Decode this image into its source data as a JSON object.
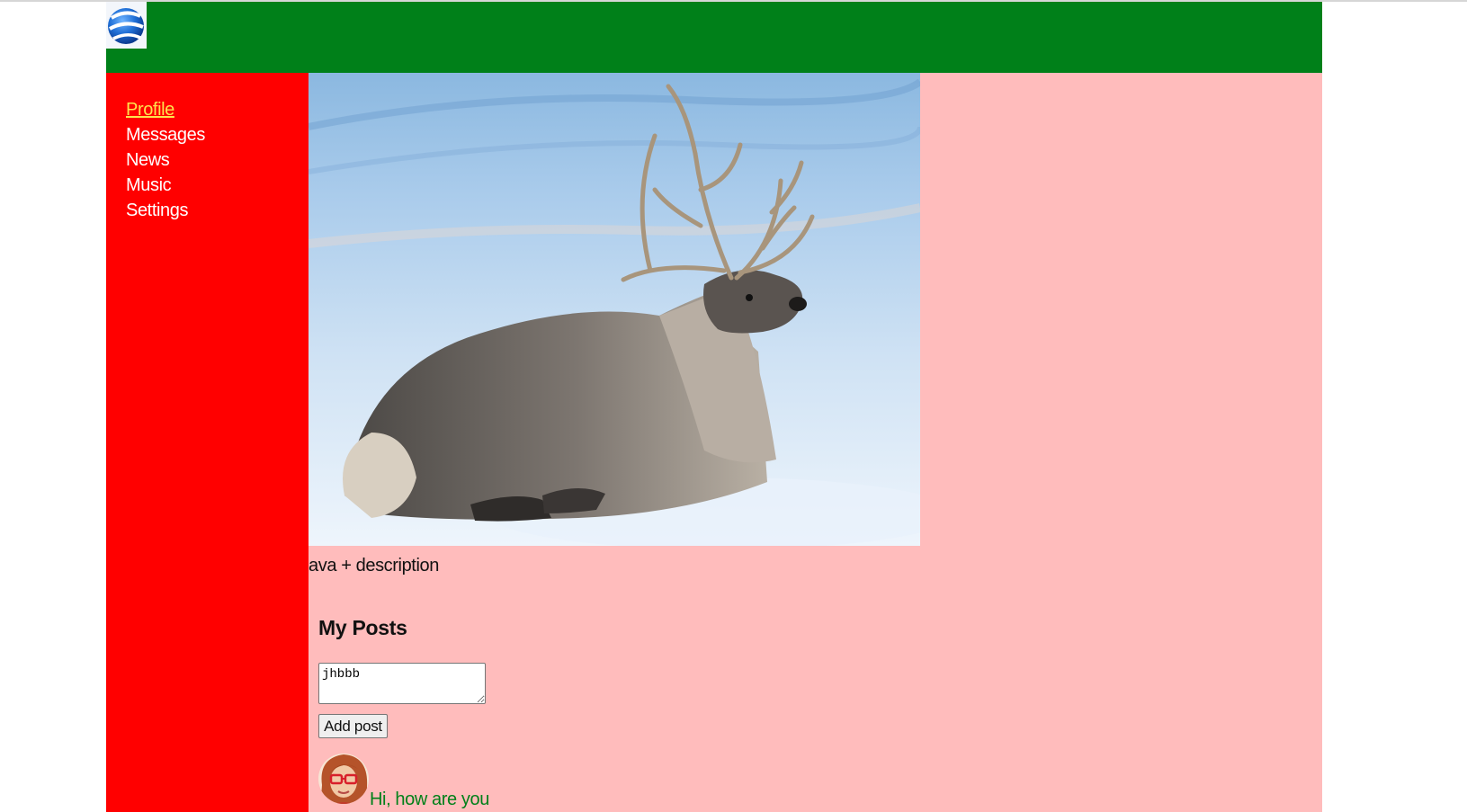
{
  "header": {
    "logo_icon": "globe-logo-icon",
    "background": "#008019"
  },
  "sidebar": {
    "background": "#ff0000",
    "items": [
      {
        "label": "Profile",
        "active": true
      },
      {
        "label": "Messages",
        "active": false
      },
      {
        "label": "News",
        "active": false
      },
      {
        "label": "Music",
        "active": false
      },
      {
        "label": "Settings",
        "active": false
      }
    ]
  },
  "profile": {
    "background": "#ffbcbc",
    "image_icon": "reindeer-photo",
    "description": "ava + description"
  },
  "posts": {
    "title": "My Posts",
    "input_value": "jhbbb",
    "add_button_label": "Add post",
    "items": [
      {
        "avatar_icon": "user-avatar",
        "text": "Hi, how are you",
        "color": "#008019"
      }
    ]
  }
}
